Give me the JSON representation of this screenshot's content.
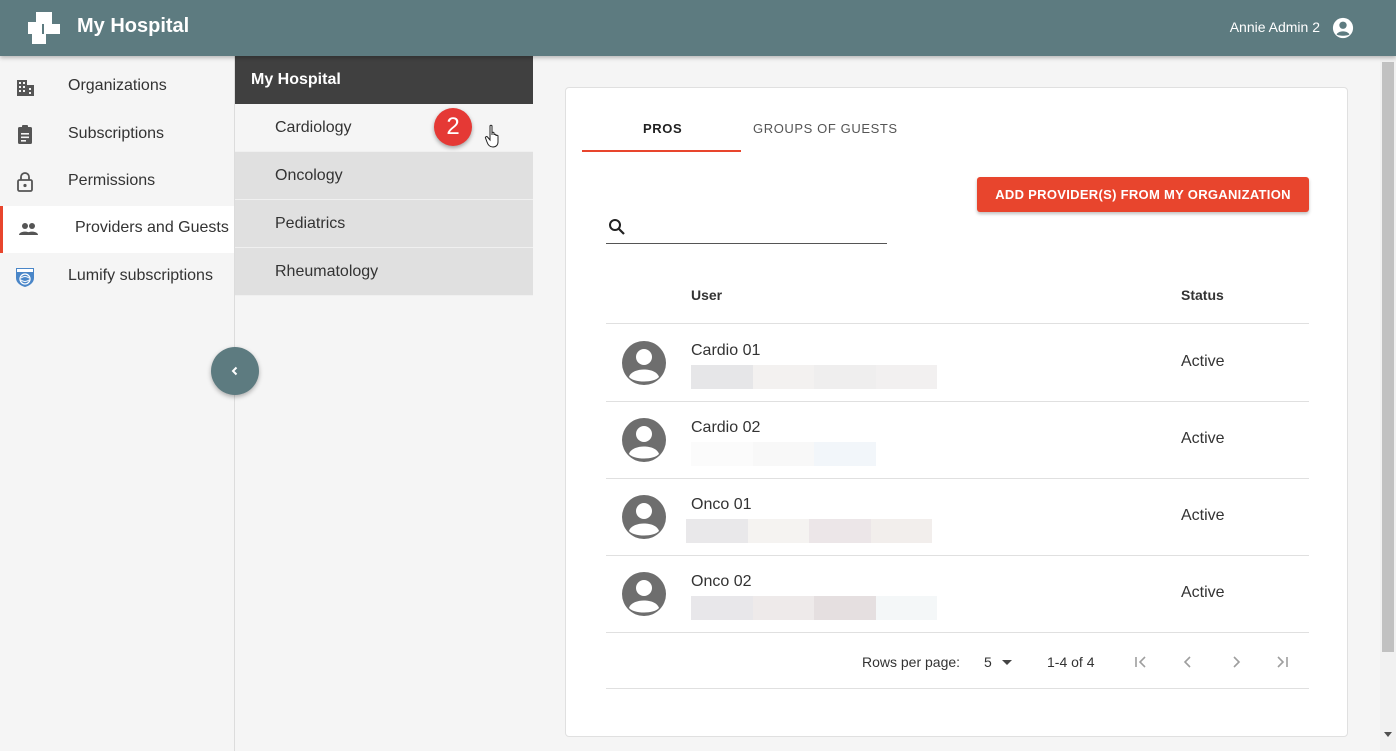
{
  "header": {
    "app_title": "My Hospital",
    "user_name": "Annie Admin 2",
    "bg_color": "#5d7b80"
  },
  "sidebar": {
    "items": [
      {
        "label": "Organizations",
        "icon": "building-icon"
      },
      {
        "label": "Subscriptions",
        "icon": "clipboard-icon"
      },
      {
        "label": "Permissions",
        "icon": "lock-icon"
      },
      {
        "label": "Providers and Guests",
        "icon": "people-icon",
        "active": true
      },
      {
        "label": "Lumify subscriptions",
        "icon": "philips-shield-icon"
      }
    ]
  },
  "subpanel": {
    "header": "My Hospital",
    "items": [
      {
        "label": "Cardiology",
        "selected": true
      },
      {
        "label": "Oncology"
      },
      {
        "label": "Pediatrics"
      },
      {
        "label": "Rheumatology"
      }
    ]
  },
  "step_badge": "2",
  "main": {
    "tabs": [
      {
        "label": "PROS",
        "active": true
      },
      {
        "label": "GROUPS OF GUESTS"
      }
    ],
    "add_button": "ADD PROVIDER(S) FROM MY ORGANIZATION",
    "search": {
      "value": "",
      "placeholder": ""
    },
    "columns": {
      "user": "User",
      "status": "Status"
    },
    "rows": [
      {
        "name": "Cardio 01",
        "status": "Active"
      },
      {
        "name": "Cardio 02",
        "status": "Active"
      },
      {
        "name": "Onco 01",
        "status": "Active"
      },
      {
        "name": "Onco 02",
        "status": "Active"
      }
    ],
    "pagination": {
      "rows_per_page_label": "Rows per page:",
      "rows_per_page_value": "5",
      "range": "1-4 of 4"
    },
    "accent_color": "#e8452d"
  }
}
